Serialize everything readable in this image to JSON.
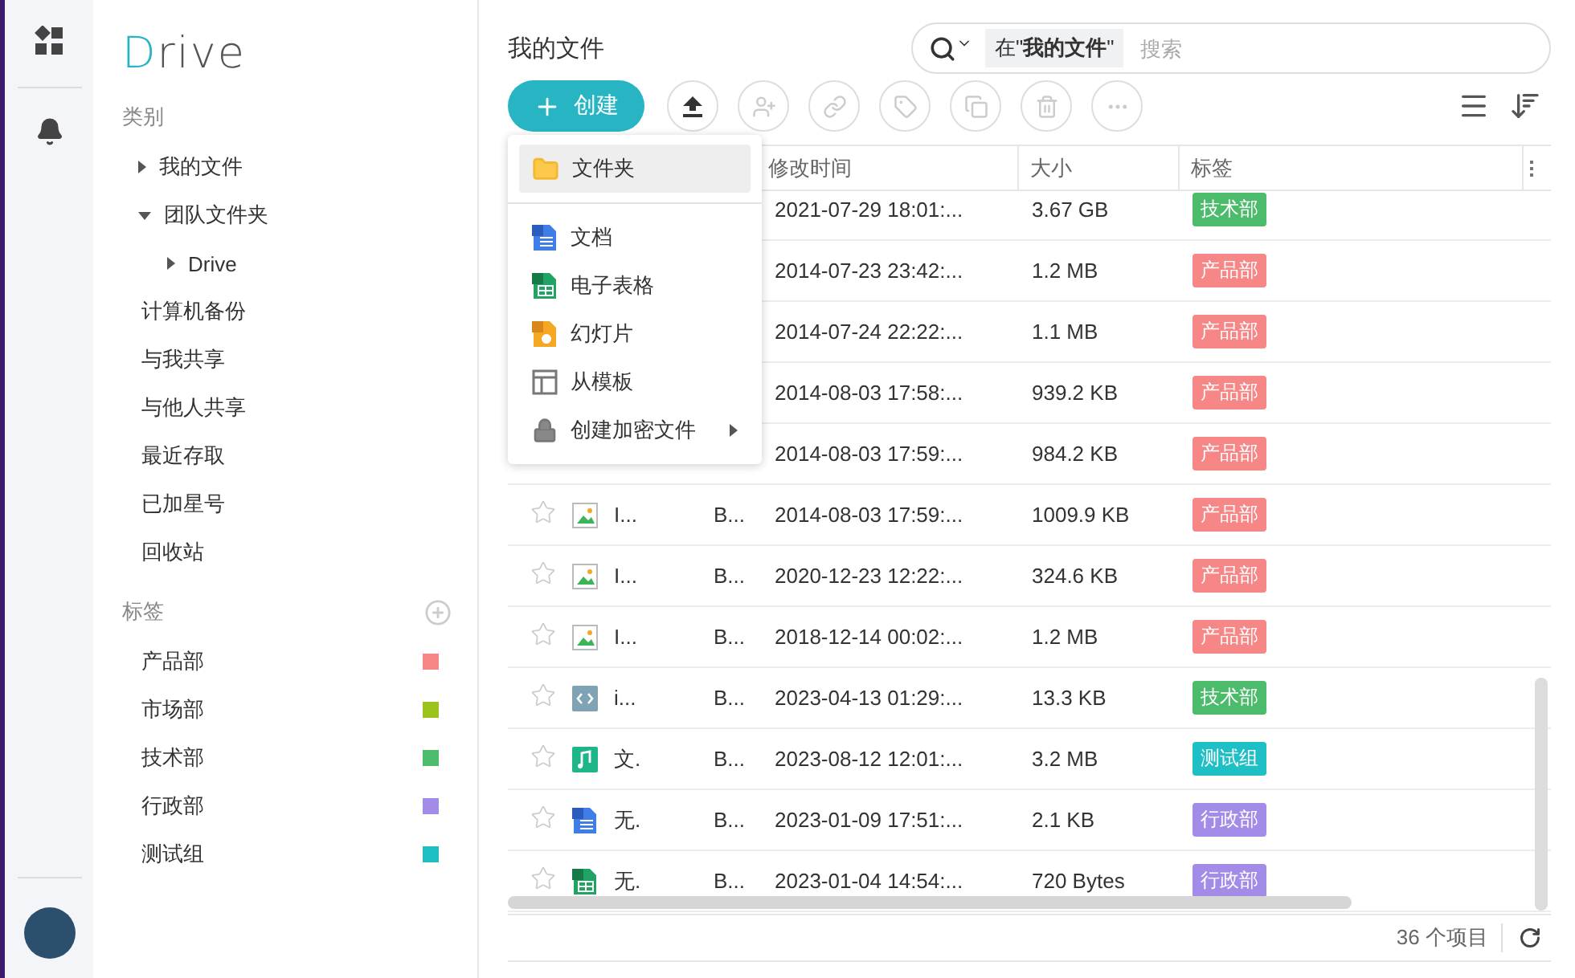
{
  "logo": "Drive",
  "sidebar": {
    "categories_title": "类别",
    "categories": [
      {
        "label": "我的文件",
        "kind": "folder",
        "expanded": false
      },
      {
        "label": "团队文件夹",
        "kind": "folder",
        "expanded": true,
        "children": [
          {
            "label": "Drive",
            "kind": "folder",
            "expanded": false
          }
        ]
      },
      {
        "label": "计算机备份",
        "kind": "link"
      },
      {
        "label": "与我共享",
        "kind": "link"
      },
      {
        "label": "与他人共享",
        "kind": "link"
      },
      {
        "label": "最近存取",
        "kind": "link"
      },
      {
        "label": "已加星号",
        "kind": "link"
      },
      {
        "label": "回收站",
        "kind": "link"
      }
    ],
    "tags_title": "标签",
    "tags": [
      {
        "label": "产品部",
        "color": "#f78787"
      },
      {
        "label": "市场部",
        "color": "#9bc31c"
      },
      {
        "label": "技术部",
        "color": "#4cbb6c"
      },
      {
        "label": "行政部",
        "color": "#a38ce8"
      },
      {
        "label": "测试组",
        "color": "#1fbfc6"
      }
    ]
  },
  "page_title": "我的文件",
  "search": {
    "scope": "在\"**我的文件**\"",
    "placeholder": "搜索"
  },
  "create_button": "创建",
  "create_menu": [
    {
      "label": "文件夹",
      "kind": "folder",
      "selected": true,
      "submenu": false
    },
    {
      "label": "文档",
      "kind": "doc",
      "selected": false,
      "submenu": false
    },
    {
      "label": "电子表格",
      "kind": "sheet",
      "selected": false,
      "submenu": false
    },
    {
      "label": "幻灯片",
      "kind": "slide",
      "selected": false,
      "submenu": false
    },
    {
      "label": "从模板",
      "kind": "template",
      "selected": false,
      "submenu": false
    },
    {
      "label": "创建加密文件",
      "kind": "lock",
      "selected": false,
      "submenu": true
    }
  ],
  "table": {
    "columns": [
      "修改时间",
      "大小",
      "标签"
    ],
    "rows": [
      {
        "modified": "2021-07-29 18:01:...",
        "size": "3.67 GB",
        "tag": {
          "label": "技术部",
          "color": "#4cbb6c"
        }
      },
      {
        "modified": "2014-07-23 23:42:...",
        "size": "1.2 MB",
        "tag": {
          "label": "产品部",
          "color": "#f78787"
        }
      },
      {
        "modified": "2014-07-24 22:22:...",
        "size": "1.1 MB",
        "tag": {
          "label": "产品部",
          "color": "#f78787"
        }
      },
      {
        "modified": "2014-08-03 17:58:...",
        "size": "939.2 KB",
        "tag": {
          "label": "产品部",
          "color": "#f78787"
        }
      },
      {
        "modified": "2014-08-03 17:59:...",
        "size": "984.2 KB",
        "tag": {
          "label": "产品部",
          "color": "#f78787"
        }
      },
      {
        "starred": false,
        "kind": "image",
        "name": "I...",
        "owner": "B...",
        "modified": "2014-08-03 17:59:...",
        "size": "1009.9 KB",
        "tag": {
          "label": "产品部",
          "color": "#f78787"
        }
      },
      {
        "starred": false,
        "kind": "image",
        "name": "I...",
        "owner": "B...",
        "modified": "2020-12-23 12:22:...",
        "size": "324.6 KB",
        "tag": {
          "label": "产品部",
          "color": "#f78787"
        }
      },
      {
        "starred": false,
        "kind": "image",
        "name": "I...",
        "owner": "B...",
        "modified": "2018-12-14 00:02:...",
        "size": "1.2 MB",
        "tag": {
          "label": "产品部",
          "color": "#f78787"
        }
      },
      {
        "starred": false,
        "kind": "code",
        "name": "i...",
        "owner": "B...",
        "modified": "2023-04-13 01:29:...",
        "size": "13.3 KB",
        "tag": {
          "label": "技术部",
          "color": "#4cbb6c"
        }
      },
      {
        "starred": false,
        "kind": "audio",
        "name": "文.",
        "owner": "B...",
        "modified": "2023-08-12 12:01:...",
        "size": "3.2 MB",
        "tag": {
          "label": "测试组",
          "color": "#1fbfc6"
        }
      },
      {
        "starred": false,
        "kind": "doc",
        "name": "无.",
        "owner": "B...",
        "modified": "2023-01-09 17:51:...",
        "size": "2.1 KB",
        "tag": {
          "label": "行政部",
          "color": "#a38ce8"
        }
      },
      {
        "starred": false,
        "kind": "sheet",
        "name": "无.",
        "owner": "B...",
        "modified": "2023-01-04 14:54:...",
        "size": "720 Bytes",
        "tag": {
          "label": "行政部",
          "color": "#a38ce8"
        }
      }
    ]
  },
  "footer": {
    "count": "36 个项目"
  }
}
